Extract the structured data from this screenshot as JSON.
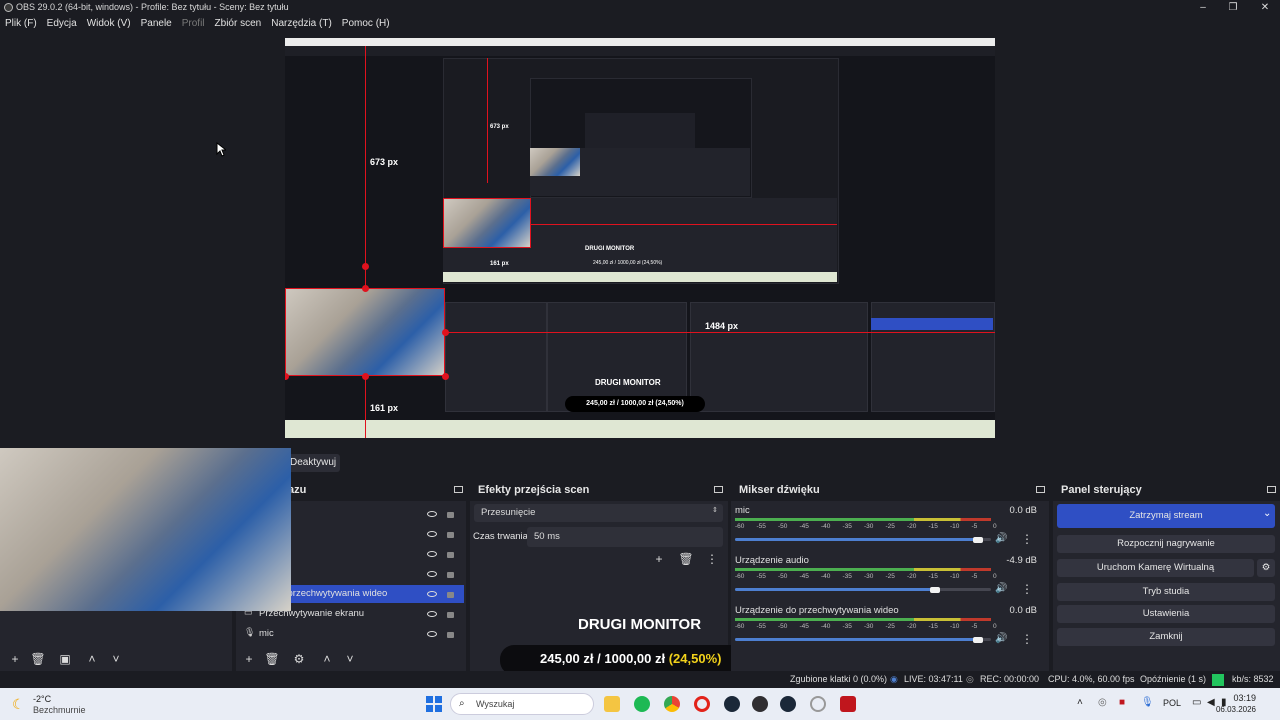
{
  "window": {
    "title": "OBS 29.0.2 (64-bit, windows) - Profile: Bez tytułu - Sceny: Bez tytułu",
    "controls": [
      "–",
      "❐",
      "✕"
    ]
  },
  "menu": [
    {
      "label": "Plik (F)",
      "disabled": false
    },
    {
      "label": "Edycja",
      "disabled": false
    },
    {
      "label": "Widok (V)",
      "disabled": false
    },
    {
      "label": "Panele",
      "disabled": false
    },
    {
      "label": "Profil",
      "disabled": true
    },
    {
      "label": "Zbiór scen",
      "disabled": false
    },
    {
      "label": "Narzędzia (T)",
      "disabled": false
    },
    {
      "label": "Pomoc (H)",
      "disabled": false
    }
  ],
  "preview": {
    "measure_vertical": "673 px",
    "measure_vertical_small": "673 px",
    "measure_bottom": "161 px",
    "measure_bottom_small": "161 px",
    "measure_right": "1484 px",
    "nested_label": "DRUGI MONITOR",
    "nested_money": "245,00 zł / 1000,00 zł (24,50%)"
  },
  "deactivate_label": "Deaktywuj",
  "sources": {
    "title": "azu",
    "items": [
      {
        "label": "",
        "icon": ""
      },
      {
        "label": "",
        "icon": ""
      },
      {
        "label": "",
        "icon": ""
      },
      {
        "label": "",
        "icon": ""
      },
      {
        "label": "nie do przechwytywania wideo",
        "icon": "",
        "selected": true
      },
      {
        "label": "Przechwytywanie ekranu",
        "icon": "monitor-icon"
      },
      {
        "label": "mic",
        "icon": "mic-icon"
      }
    ]
  },
  "transitions": {
    "title": "Efekty przejścia scen",
    "selected": "Przesunięcie",
    "duration_label": "Czas trwania",
    "duration_value": "50 ms"
  },
  "overlay": {
    "title": "DRUGI MONITOR",
    "amount": "245,00 zł",
    "separator": "/",
    "goal": "1000,00 zł",
    "percent": "(24,50%)"
  },
  "mixer": {
    "title": "Mikser dźwięku",
    "scale": [
      "-60",
      "-55",
      "-50",
      "-45",
      "-40",
      "-35",
      "-30",
      "-25",
      "-20",
      "-15",
      "-10",
      "-5",
      "0"
    ],
    "channels": [
      {
        "name": "mic",
        "db": "0.0 dB",
        "volume": 0.95
      },
      {
        "name": "Urządzenie audio",
        "db": "-4.9 dB",
        "volume": 0.78
      },
      {
        "name": "Urządzenie do przechwytywania wideo",
        "db": "0.0 dB",
        "volume": 0.95
      }
    ]
  },
  "controls": {
    "title": "Panel sterujący",
    "buttons": [
      "Zatrzymaj stream",
      "Rozpocznij nagrywanie",
      "Uruchom Kamerę Wirtualną",
      "Tryb studia",
      "Ustawienia",
      "Zamknij"
    ]
  },
  "status": {
    "dropped": "Zgubione klatki 0 (0.0%)",
    "live": "LIVE: 03:47:11",
    "rec": "REC: 00:00:00",
    "cpu": "CPU: 4.0%, 60.00 fps",
    "delay": "Opóźnienie (1 s)",
    "kbs": "kb/s: 8532"
  },
  "taskbar": {
    "temp": "-2°C",
    "weather": "Bezchmurnie",
    "search": "Wyszukaj",
    "lang": "POL",
    "time": "03:19",
    "date": "06.03.2026"
  },
  "colors": {
    "accent": "#2f4fc4",
    "red": "#e0121e",
    "green": "#22c55e"
  }
}
